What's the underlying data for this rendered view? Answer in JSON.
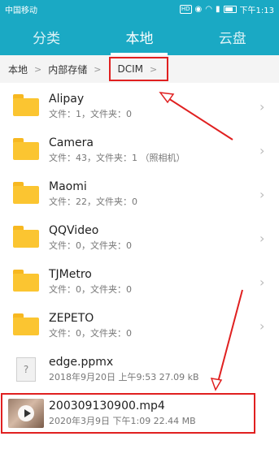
{
  "status_bar": {
    "carrier": "中国移动",
    "hd_badge": "HD",
    "time": "下午1:13"
  },
  "tabs": [
    {
      "label": "分类",
      "active": false
    },
    {
      "label": "本地",
      "active": true
    },
    {
      "label": "云盘",
      "active": false
    }
  ],
  "breadcrumb": {
    "items": [
      "本地",
      "内部存储"
    ],
    "current": "DCIM"
  },
  "files": [
    {
      "name": "Alipay",
      "meta": "文件：1，文件夹：0",
      "type": "folder",
      "icon": "folder-icon"
    },
    {
      "name": "Camera",
      "meta": "文件：43，文件夹：1 （照相机）",
      "type": "folder",
      "icon": "folder-icon"
    },
    {
      "name": "Maomi",
      "meta": "文件：22，文件夹：0",
      "type": "folder",
      "icon": "folder-icon"
    },
    {
      "name": "QQVideo",
      "meta": "文件：0，文件夹：0",
      "type": "folder",
      "icon": "folder-icon"
    },
    {
      "name": "TJMetro",
      "meta": "文件：0，文件夹：0",
      "type": "folder",
      "icon": "folder-icon"
    },
    {
      "name": "ZEPETO",
      "meta": "文件：0，文件夹：0",
      "type": "folder",
      "icon": "folder-icon"
    },
    {
      "name": "edge.ppmx",
      "meta": "2018年9月20日 上午9:53 27.09 kB",
      "type": "file",
      "icon": "unknown-file-icon",
      "glyph": "?"
    },
    {
      "name": "200309130900.mp4",
      "meta": "2020年3月9日 下午1:09 22.44 MB",
      "type": "video",
      "icon": "video-thumbnail-icon"
    }
  ],
  "colors": {
    "accent": "#1aa9c4",
    "annotation_red": "#e02020",
    "folder": "#fbc531"
  }
}
